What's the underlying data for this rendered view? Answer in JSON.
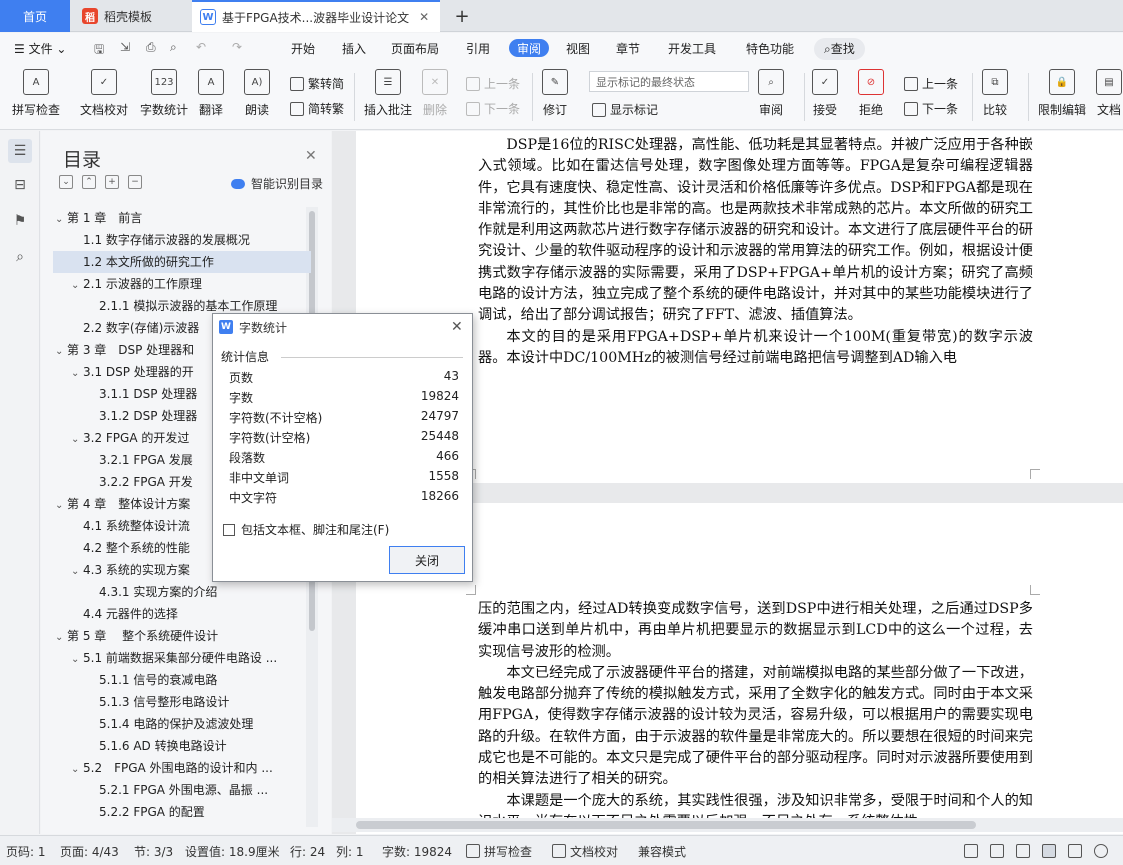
{
  "tabs": {
    "home": "首页",
    "template": "稻壳模板",
    "document": "基于FPGA技术...波器毕业设计论文"
  },
  "menu": {
    "file": "文件",
    "items": [
      "开始",
      "插入",
      "页面布局",
      "引用",
      "审阅",
      "视图",
      "章节",
      "开发工具",
      "特色功能"
    ],
    "active": "审阅",
    "search": "查找"
  },
  "ribbon": {
    "spell_check": "拼写检查",
    "doc_proof": "文档校对",
    "word_count": "字数统计",
    "translate": "翻译",
    "read_aloud": "朗读",
    "trad_to_simp": "繁转简",
    "simp_to_trad": "简转繁",
    "insert_comment": "插入批注",
    "delete": "删除",
    "prev_comment": "上一条",
    "next_comment": "下一条",
    "revise": "修订",
    "mark_state": "显示标记的最终状态",
    "show_marks": "显示标记",
    "review": "审阅",
    "accept": "接受",
    "reject": "拒绝",
    "prev": "上一条",
    "next": "下一条",
    "compare": "比较",
    "restrict_edit": "限制编辑",
    "doc_right": "文档"
  },
  "toc": {
    "title": "目录",
    "smart": "智能识别目录",
    "items": [
      {
        "label": "第 1 章　前言",
        "level": 0,
        "arrow": true
      },
      {
        "label": "1.1 数字存储示波器的发展概况",
        "level": 1,
        "arrow": false
      },
      {
        "label": "1.2 本文所做的研究工作",
        "level": 1,
        "arrow": false,
        "selected": true
      },
      {
        "label": "2.1  示波器的工作原理",
        "level": 1,
        "arrow": true
      },
      {
        "label": "2.1.1 模拟示波器的基本工作原理",
        "level": 2,
        "arrow": false
      },
      {
        "label": "2.2  数字(存储)示波器",
        "level": 1,
        "arrow": false
      },
      {
        "label": "第 3 章　DSP 处理器和",
        "level": 0,
        "arrow": true
      },
      {
        "label": "3.1 DSP 处理器的开",
        "level": 1,
        "arrow": true
      },
      {
        "label": "3.1.1 DSP 处理器",
        "level": 2,
        "arrow": false
      },
      {
        "label": "3.1.2 DSP 处理器",
        "level": 2,
        "arrow": false
      },
      {
        "label": "3.2 FPGA 的开发过",
        "level": 1,
        "arrow": true
      },
      {
        "label": "3.2.1 FPGA 发展",
        "level": 2,
        "arrow": false
      },
      {
        "label": "3.2.2 FPGA 开发",
        "level": 2,
        "arrow": false
      },
      {
        "label": "第 4 章　整体设计方案",
        "level": 0,
        "arrow": true
      },
      {
        "label": "4.1 系统整体设计流",
        "level": 1,
        "arrow": false
      },
      {
        "label": "4.2 整个系统的性能",
        "level": 1,
        "arrow": false
      },
      {
        "label": "4.3 系统的实现方案",
        "level": 1,
        "arrow": true
      },
      {
        "label": "4.3.1 实现方案的介绍",
        "level": 2,
        "arrow": false
      },
      {
        "label": "4.4 元器件的选择",
        "level": 1,
        "arrow": false
      },
      {
        "label": "第 5 章　 整个系统硬件设计",
        "level": 0,
        "arrow": true
      },
      {
        "label": "5.1 前端数据采集部分硬件电路设 ...",
        "level": 1,
        "arrow": true
      },
      {
        "label": "5.1.1 信号的衰减电路",
        "level": 2,
        "arrow": false
      },
      {
        "label": "5.1.3  信号整形电路设计",
        "level": 2,
        "arrow": false
      },
      {
        "label": "5.1.4  电路的保护及滤波处理",
        "level": 2,
        "arrow": false
      },
      {
        "label": "5.1.6 AD 转换电路设计",
        "level": 2,
        "arrow": false
      },
      {
        "label": "5.2　FPGA 外围电路的设计和内 ...",
        "level": 1,
        "arrow": true
      },
      {
        "label": "5.2.1 FPGA 外围电源、晶振 ...",
        "level": 2,
        "arrow": false
      },
      {
        "label": "5.2.2 FPGA 的配置",
        "level": 2,
        "arrow": false
      }
    ]
  },
  "dialog": {
    "title": "字数统计",
    "section": "统计信息",
    "stats": [
      {
        "label": "页数",
        "value": "43"
      },
      {
        "label": "字数",
        "value": "19824"
      },
      {
        "label": "字符数(不计空格)",
        "value": "24797"
      },
      {
        "label": "字符数(计空格)",
        "value": "25448"
      },
      {
        "label": "段落数",
        "value": "466"
      },
      {
        "label": "非中文单词",
        "value": "1558"
      },
      {
        "label": "中文字符",
        "value": "18266"
      }
    ],
    "checkbox": "包括文本框、脚注和尾注(F)",
    "close": "关闭"
  },
  "doc": {
    "page1": [
      "DSP是16位的RISC处理器，高性能、低功耗是其显著特点。并被广泛应用于各种嵌入式领域。比如在雷达信号处理，数字图像处理方面等等。FPGA是复杂可编程逻辑器件，它具有速度快、稳定性高、设计灵活和价格低廉等许多优点。DSP和FPGA都是现在非常流行的，其性价比也是非常的高。也是两款技术非常成熟的芯片。本文所做的研究工作就是利用这两款芯片进行数字存储示波器的研究和设计。本文进行了底层硬件平台的研究设计、少量的软件驱动程序的设计和示波器的常用算法的研究工作。例如，根据设计便携式数字存储示波器的实际需要，采用了DSP+FPGA+单片机的设计方案；研究了高频电路的设计方法，独立完成了整个系统的硬件电路设计，并对其中的某些功能模块进行了调试，给出了部分调试报告；研究了FFT、滤波、插值算法。",
      "本文的目的是采用FPGA+DSP+单片机来设计一个100M(重复带宽)的数字示波器。本设计中DC/100MHz的被测信号经过前端电路把信号调整到AD输入电"
    ],
    "page2_cont": "压的范围之内，经过AD转换变成数字信号，送到DSP中进行相关处理，之后通过DSP多缓冲串口送到单片机中，再由单片机把要显示的数据显示到LCD中的这么一个过程，去实现信号波形的检测。",
    "page2": [
      "本文已经完成了示波器硬件平台的搭建，对前端模拟电路的某些部分做了一下改进，触发电路部分抛弃了传统的模拟触发方式，采用了全数字化的触发方式。同时由于本文采用FPGA，使得数字存储示波器的设计较为灵活，容易升级，可以根据用户的需要实现电路的升级。在软件方面，由于示波器的软件量是非常庞大的。所以要想在很短的时间来完成它也是不可能的。本文只是完成了硬件平台的部分驱动程序。同时对示波器所要使用到的相关算法进行了相关的研究。",
      "本课题是一个庞大的系统，其实践性很强，涉及知识非常多，受限于时间和个人的知识水平，尚存在以下不足之处需要以后加强。不足之处有，系统整体性"
    ]
  },
  "status": {
    "page_no": "页码: 1",
    "pages": "页面: 4/43",
    "section": "节: 3/3",
    "setting": "设置值: 18.9厘米",
    "row": "行: 24",
    "col": "列: 1",
    "words": "字数: 19824",
    "spell": "拼写检查",
    "proof": "文档校对",
    "compat": "兼容模式"
  }
}
